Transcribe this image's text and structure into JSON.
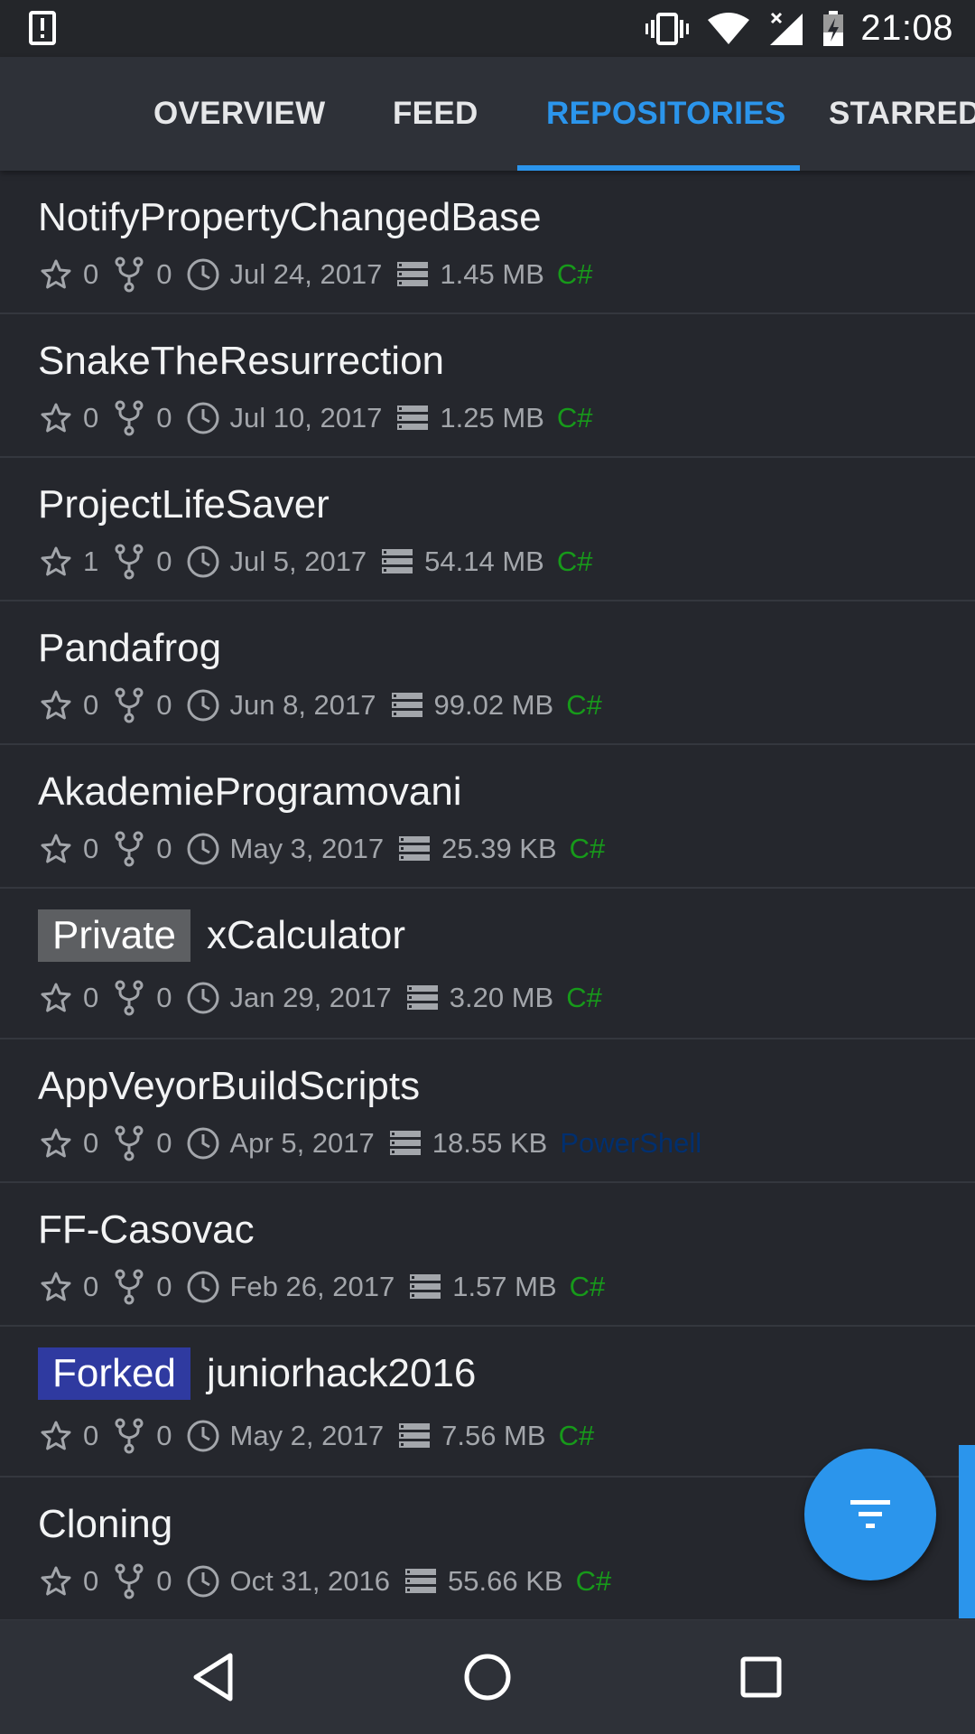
{
  "status_bar": {
    "time": "21:08",
    "icons": [
      "alert-icon",
      "vibrate-icon",
      "wifi-icon",
      "signal-icon",
      "battery-charging-icon"
    ]
  },
  "tabs": [
    {
      "label": "OVERVIEW",
      "active": false
    },
    {
      "label": "FEED",
      "active": false
    },
    {
      "label": "REPOSITORIES",
      "active": true
    },
    {
      "label": "STARRED",
      "active": false
    }
  ],
  "accent_color": "#2b95ec",
  "language_colors": {
    "C#": "#179a1a",
    "PowerShell": "#012f6e"
  },
  "repos": [
    {
      "name": "NotifyPropertyChangedBase",
      "badge": "",
      "stars": "0",
      "forks": "0",
      "date": "Jul 24, 2017",
      "size": "1.45 MB",
      "language": "C#"
    },
    {
      "name": "SnakeTheResurrection",
      "badge": "",
      "stars": "0",
      "forks": "0",
      "date": "Jul 10, 2017",
      "size": "1.25 MB",
      "language": "C#"
    },
    {
      "name": "ProjectLifeSaver",
      "badge": "",
      "stars": "1",
      "forks": "0",
      "date": "Jul 5, 2017",
      "size": "54.14 MB",
      "language": "C#"
    },
    {
      "name": "Pandafrog",
      "badge": "",
      "stars": "0",
      "forks": "0",
      "date": "Jun 8, 2017",
      "size": "99.02 MB",
      "language": "C#"
    },
    {
      "name": "AkademieProgramovani",
      "badge": "",
      "stars": "0",
      "forks": "0",
      "date": "May 3, 2017",
      "size": "25.39 KB",
      "language": "C#"
    },
    {
      "name": "xCalculator",
      "badge": "Private",
      "stars": "0",
      "forks": "0",
      "date": "Jan 29, 2017",
      "size": "3.20 MB",
      "language": "C#"
    },
    {
      "name": "AppVeyorBuildScripts",
      "badge": "",
      "stars": "0",
      "forks": "0",
      "date": "Apr 5, 2017",
      "size": "18.55 KB",
      "language": "PowerShell"
    },
    {
      "name": "FF-Casovac",
      "badge": "",
      "stars": "0",
      "forks": "0",
      "date": "Feb 26, 2017",
      "size": "1.57 MB",
      "language": "C#"
    },
    {
      "name": "juniorhack2016",
      "badge": "Forked",
      "stars": "0",
      "forks": "0",
      "date": "May 2, 2017",
      "size": "7.56 MB",
      "language": "C#"
    },
    {
      "name": "Cloning",
      "badge": "",
      "stars": "0",
      "forks": "0",
      "date": "Oct 31, 2016",
      "size": "55.66 KB",
      "language": "C#"
    }
  ],
  "fab": {
    "icon": "filter-icon"
  },
  "nav_bar": {
    "icons": [
      "back-icon",
      "home-icon",
      "recents-icon"
    ]
  }
}
